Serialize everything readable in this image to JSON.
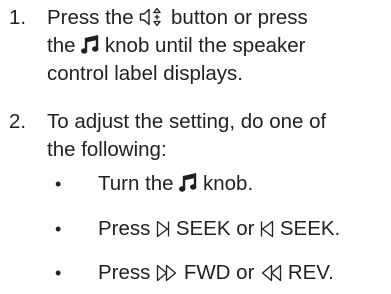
{
  "steps": [
    {
      "number": "1.",
      "line1_pre": "Press the",
      "line1_icon": "speaker-control-icon",
      "line1_post": "button or press",
      "line2_pre": "the",
      "line2_icon": "music-note-knob-icon",
      "line2_post": "knob until the speaker",
      "line3": "control label displays."
    },
    {
      "number": "2.",
      "line1": "To adjust the setting, do one of",
      "line2": "the following:"
    }
  ],
  "bullets": [
    {
      "symbol": "•",
      "pre": "Turn the",
      "icon": "music-note-knob-icon",
      "post": "knob."
    },
    {
      "symbol": "•",
      "pre": "Press",
      "icon1": "seek-forward-icon",
      "mid": "SEEK or",
      "icon2": "seek-back-icon",
      "post": "SEEK."
    },
    {
      "symbol": "•",
      "pre": "Press",
      "icon1": "fast-forward-icon",
      "mid": "FWD or",
      "icon2": "rewind-icon",
      "post": "REV."
    }
  ],
  "colors": {
    "text": "#231f20"
  }
}
